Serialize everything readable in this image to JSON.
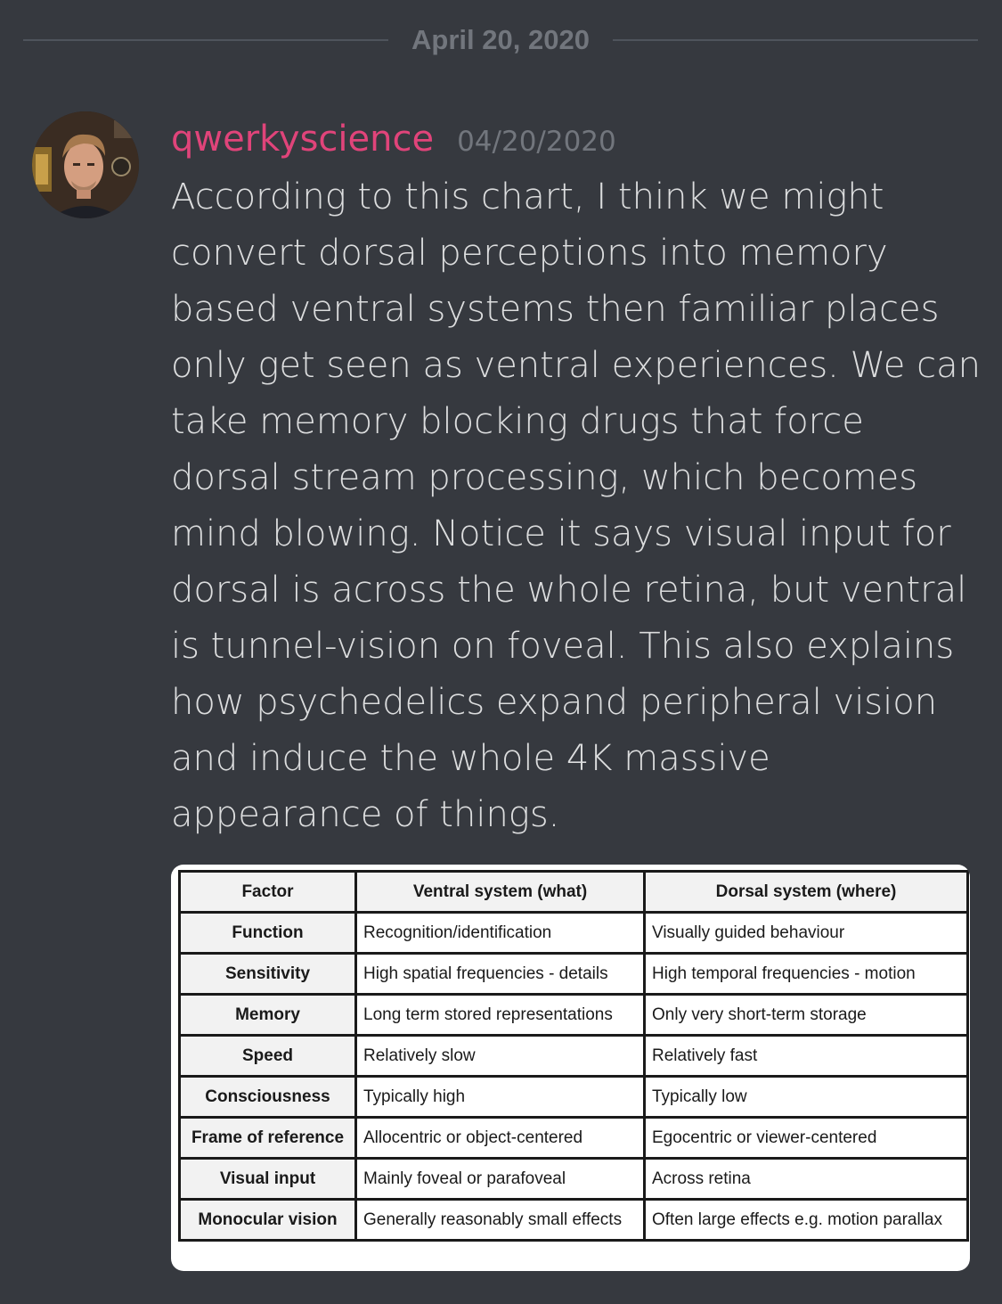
{
  "date_divider": {
    "text": "April 20, 2020"
  },
  "message": {
    "username": "qwerkyscience",
    "timestamp": "04/20/2020",
    "lines": [
      "According to this chart, I think we might",
      "convert dorsal perceptions into memory",
      "based ventral systems then familiar places",
      "only get seen as ventral experiences. We can",
      "take memory blocking drugs that force",
      "dorsal stream processing, which becomes",
      "mind blowing. Notice it says visual input for",
      "dorsal is across the whole retina, but ventral",
      "is tunnel-vision on foveal. This also explains",
      "how psychedelics expand peripheral vision",
      "and induce the whole 4K massive",
      "appearance of things."
    ],
    "colors": {
      "username": "#e0447a",
      "text": "#dcddde",
      "muted": "#72767d",
      "background": "#36393f"
    }
  },
  "table": {
    "headers": [
      "Factor",
      "Ventral system (what)",
      "Dorsal system (where)"
    ],
    "rows": [
      [
        "Function",
        "Recognition/identification",
        "Visually guided behaviour"
      ],
      [
        "Sensitivity",
        "High spatial frequencies - details",
        "High temporal frequencies - motion"
      ],
      [
        "Memory",
        "Long term stored representations",
        "Only very short-term storage"
      ],
      [
        "Speed",
        "Relatively slow",
        "Relatively fast"
      ],
      [
        "Consciousness",
        "Typically high",
        "Typically low"
      ],
      [
        "Frame of reference",
        "Allocentric or object-centered",
        "Egocentric or viewer-centered"
      ],
      [
        "Visual input",
        "Mainly foveal or parafoveal",
        "Across retina"
      ],
      [
        "Monocular vision",
        "Generally reasonably small effects",
        "Often large effects e.g. motion parallax"
      ]
    ]
  },
  "icons": {
    "avatar": "user-avatar-photo"
  }
}
